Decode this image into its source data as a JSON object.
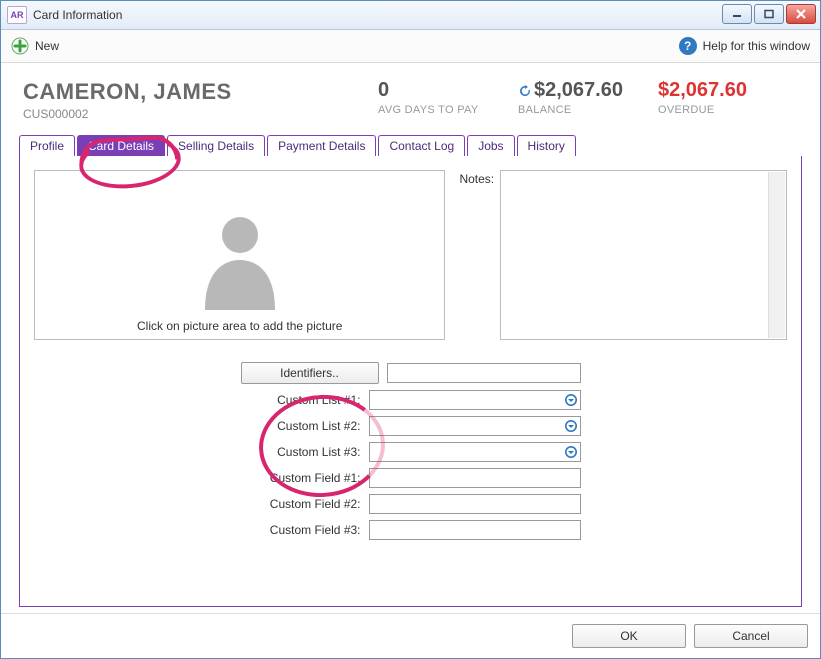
{
  "window": {
    "app_icon_text": "AR",
    "title": "Card Information"
  },
  "toolbar": {
    "new_label": "New",
    "help_label": "Help for this window"
  },
  "summary": {
    "name": "CAMERON, JAMES",
    "card_id": "CUS000002",
    "stats": [
      {
        "value": "0",
        "label": "AVG DAYS TO PAY",
        "style": "normal",
        "refresh": false
      },
      {
        "value": "$2,067.60",
        "label": "BALANCE",
        "style": "normal",
        "refresh": true
      },
      {
        "value": "$2,067.60",
        "label": "OVERDUE",
        "style": "red",
        "refresh": false
      }
    ]
  },
  "tabs": {
    "items": [
      {
        "label": "Profile"
      },
      {
        "label": "Card Details",
        "active": true
      },
      {
        "label": "Selling Details"
      },
      {
        "label": "Payment Details"
      },
      {
        "label": "Contact Log"
      },
      {
        "label": "Jobs"
      },
      {
        "label": "History"
      }
    ]
  },
  "panel": {
    "picture_hint": "Click on picture area to add the picture",
    "notes_label": "Notes:",
    "identifiers_button": "Identifiers..",
    "rows": [
      {
        "label": "Custom List #1:",
        "type": "combo",
        "value": ""
      },
      {
        "label": "Custom List #2:",
        "type": "combo",
        "value": ""
      },
      {
        "label": "Custom List #3:",
        "type": "combo",
        "value": ""
      },
      {
        "label": "Custom Field #1:",
        "type": "text",
        "value": ""
      },
      {
        "label": "Custom Field #2:",
        "type": "text",
        "value": ""
      },
      {
        "label": "Custom Field #3:",
        "type": "text",
        "value": ""
      }
    ]
  },
  "buttons": {
    "ok": "OK",
    "cancel": "Cancel"
  }
}
